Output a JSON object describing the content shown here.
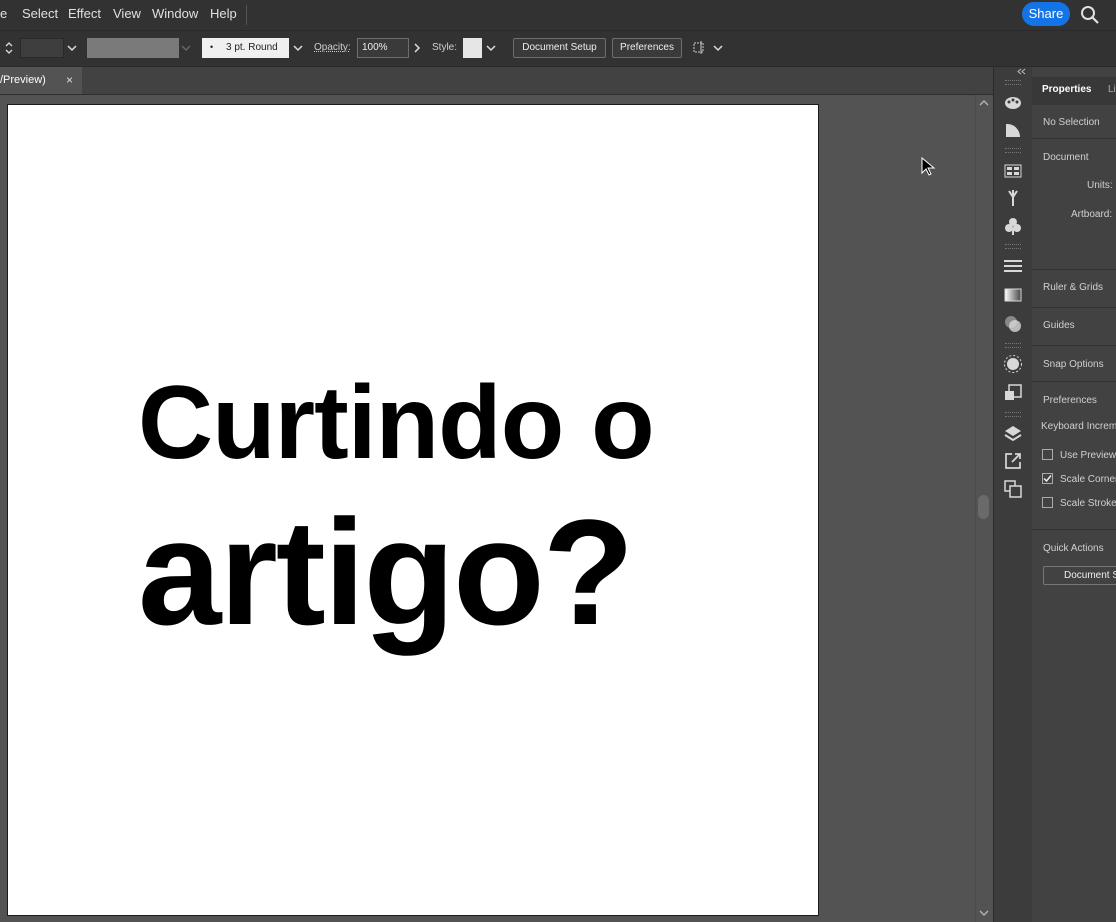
{
  "menu": {
    "items": [
      "e",
      "Select",
      "Effect",
      "View",
      "Window",
      "Help"
    ],
    "share_label": "Share"
  },
  "control_bar": {
    "stroke_profile": "3 pt. Round",
    "opacity_label": "Opacity:",
    "opacity_value": "100%",
    "style_label": "Style:",
    "document_setup_label": "Document Setup",
    "preferences_label": "Preferences"
  },
  "document_tab": {
    "label": "/Preview)",
    "close": "×"
  },
  "artboard": {
    "line1": "Curtindo o",
    "line2": "artigo?"
  },
  "panel": {
    "tabs": [
      "Properties",
      "Li"
    ],
    "selection_status": "No Selection",
    "document_heading": "Document",
    "units_label": "Units:",
    "artboard_label": "Artboard:",
    "ruler_grids": "Ruler & Grids",
    "guides": "Guides",
    "snap_options": "Snap Options",
    "preferences_heading": "Preferences",
    "keyboard_increment": "Keyboard Increm",
    "use_preview": "Use Preview",
    "scale_corners": "Scale Corner",
    "scale_strokes": "Scale Stroke",
    "quick_actions": "Quick Actions",
    "document_setup_btn": "Document S"
  },
  "colors": {
    "accent": "#1473e6",
    "ui_dark": "#323232",
    "canvas": "#535353"
  }
}
